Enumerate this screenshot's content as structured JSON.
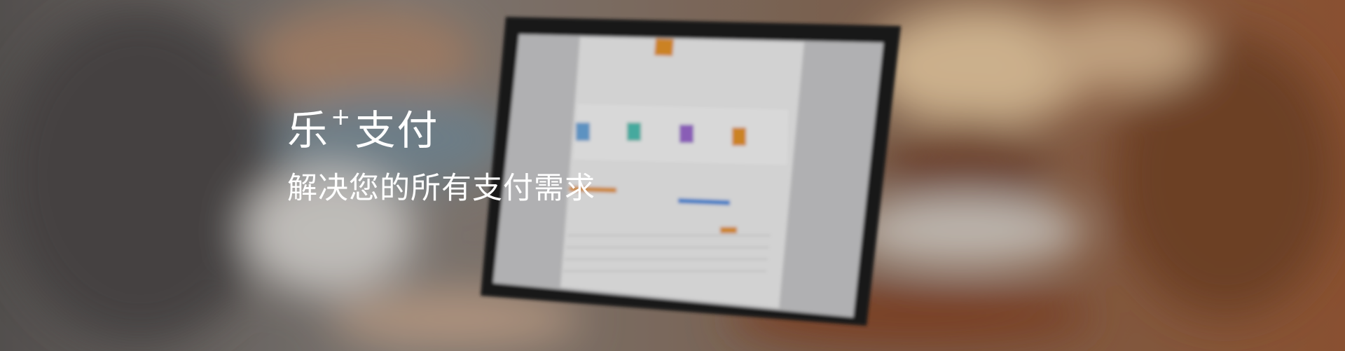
{
  "hero": {
    "title_part1": "乐",
    "title_plus": "+",
    "title_part2": "支付",
    "subtitle": "解决您的所有支付需求"
  },
  "colors": {
    "accent_orange": "#e8952a",
    "bar_blue": "#4a8ee0",
    "text": "#ffffff"
  }
}
